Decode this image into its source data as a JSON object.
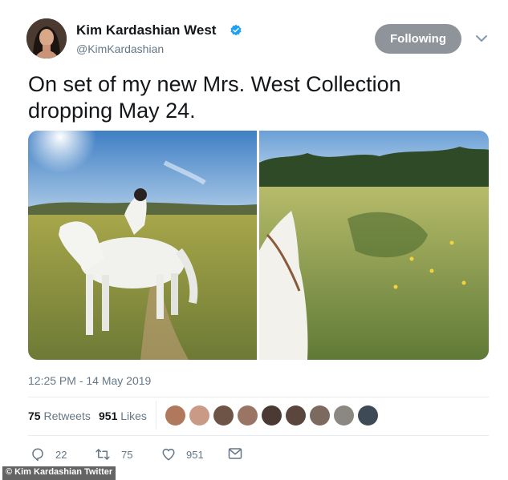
{
  "user": {
    "name": "Kim Kardashian West",
    "handle": "@KimKardashian",
    "follow_label": "Following"
  },
  "tweet": {
    "text": "On set of my new Mrs. West Collection dropping May 24.",
    "timestamp": "12:25 PM - 14 May 2019"
  },
  "stats": {
    "retweets_count": "75",
    "retweets_label": "Retweets",
    "likes_count": "951",
    "likes_label": "Likes"
  },
  "actions": {
    "reply_count": "22",
    "retweet_count": "75",
    "like_count": "951"
  },
  "likers": {
    "count": 9
  },
  "credit": "© Kim Kardashian Twitter",
  "colors": {
    "verified": "#1da1f2",
    "follow_button": "#8e9499",
    "secondary_text": "#657786"
  },
  "icons": [
    "verified-badge-icon",
    "chevron-down-icon",
    "reply-icon",
    "retweet-icon",
    "like-icon",
    "message-icon"
  ]
}
